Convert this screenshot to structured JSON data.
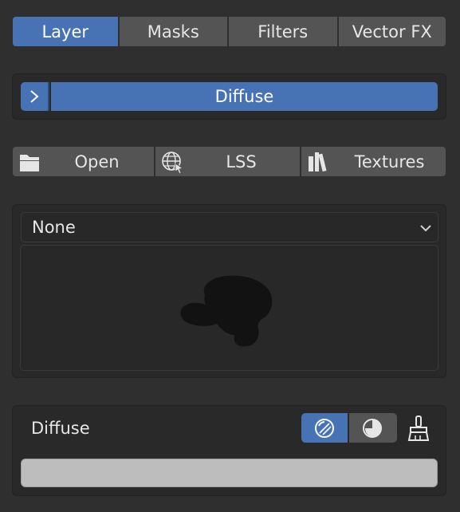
{
  "tabs": [
    {
      "label": "Layer",
      "active": true
    },
    {
      "label": "Masks",
      "active": false
    },
    {
      "label": "Filters",
      "active": false
    },
    {
      "label": "Vector FX",
      "active": false
    }
  ],
  "channel": {
    "expand_icon": "chevron-right-icon",
    "label": "Diffuse"
  },
  "actions": {
    "open": {
      "label": "Open",
      "icon": "folder-icon"
    },
    "lss": {
      "label": "LSS",
      "icon": "globe-cursor-icon"
    },
    "textures": {
      "label": "Textures",
      "icon": "library-books-icon"
    }
  },
  "image_browser": {
    "selected": "None",
    "preview_icon": "monkey-silhouette-icon"
  },
  "paint": {
    "label": "Diffuse",
    "modes": [
      {
        "icon": "sphere-shading-icon",
        "active": true
      },
      {
        "icon": "half-shading-icon",
        "active": false
      }
    ],
    "brush_icon": "brush-icon",
    "color": "#bdbdbd"
  },
  "colors": {
    "accent": "#4772b3",
    "background": "#2f2f2f",
    "button": "#545454",
    "panel": "#292929"
  }
}
